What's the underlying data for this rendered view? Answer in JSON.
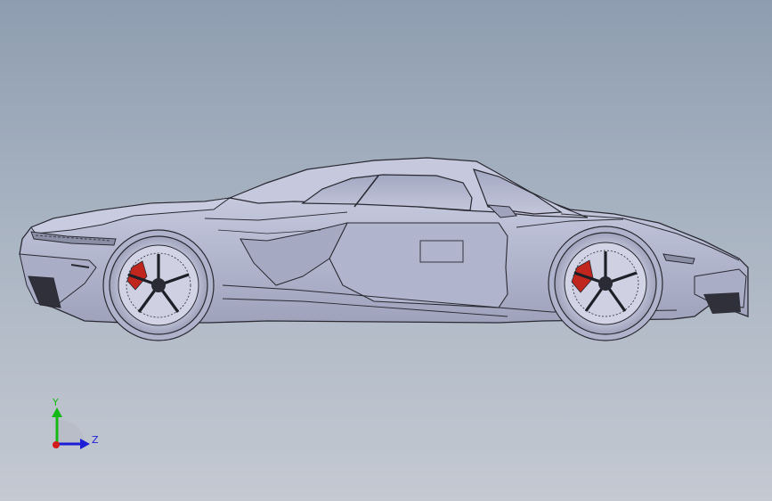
{
  "viewport": {
    "background_top": "#8e9db0",
    "background_bottom": "#c4c9d2"
  },
  "model": {
    "body_color": "#b9bdd4",
    "edge_color": "#2a2a33",
    "brake_caliper_color": "#c0261d"
  },
  "triad": {
    "y_label": "Y",
    "z_label": "Z",
    "y_color": "#16b816",
    "z_color": "#1d1dd6",
    "x_color": "#d21c1c"
  }
}
